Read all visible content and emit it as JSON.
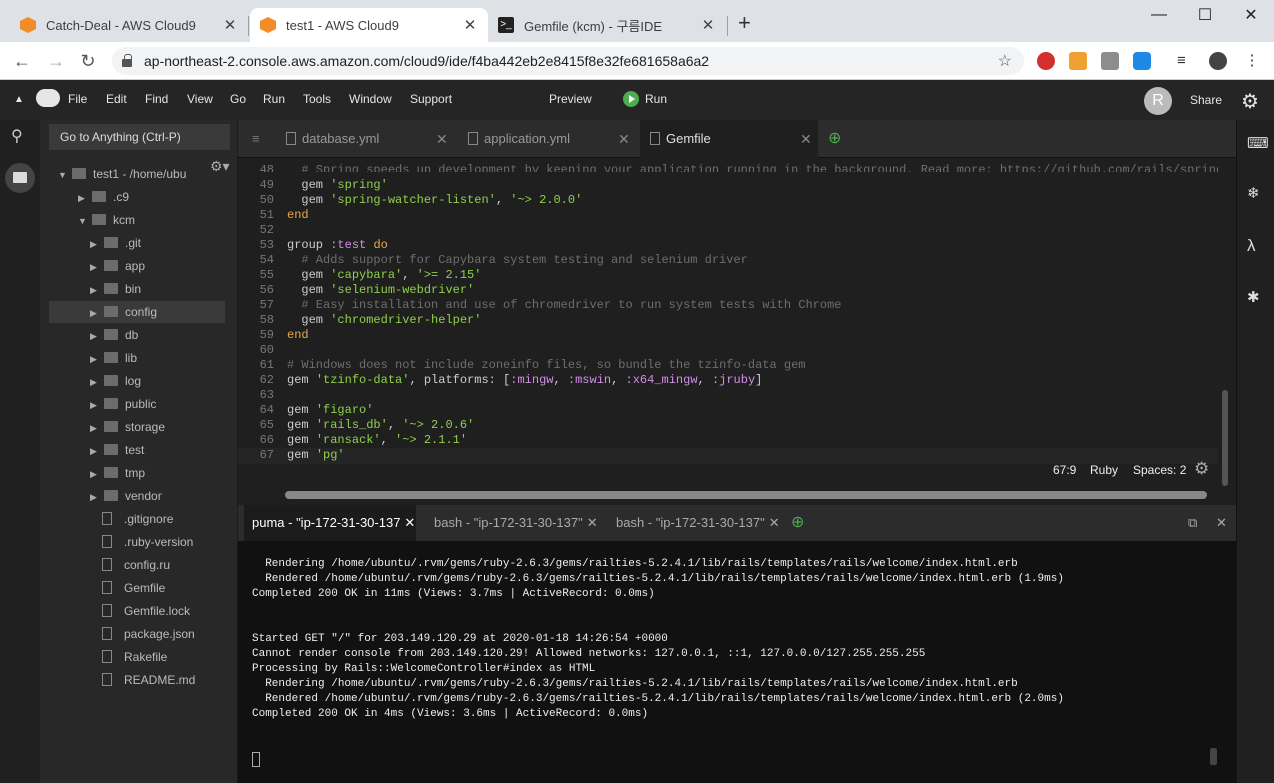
{
  "browser": {
    "tabs": [
      {
        "title": "Catch-Deal - AWS Cloud9",
        "icon": "cloud9-cube-icon"
      },
      {
        "title": "test1 - AWS Cloud9",
        "icon": "cloud9-cube-icon"
      },
      {
        "title": "Gemfile (kcm) - 구름IDE",
        "icon": "terminal-icon"
      }
    ],
    "url": "ap-northeast-2.console.aws.amazon.com/cloud9/ide/f4ba442eb2e8415f8e32fe681658a6a2",
    "new_tab": "+"
  },
  "menu": {
    "items": [
      "File",
      "Edit",
      "Find",
      "View",
      "Go",
      "Run",
      "Tools",
      "Window",
      "Support"
    ],
    "preview": "Preview",
    "run": "Run",
    "avatar": "R",
    "share": "Share"
  },
  "sidebar": {
    "goto": "Go to Anything (Ctrl-P)",
    "tree": [
      {
        "label": "test1 - /home/ubu",
        "depth": 0,
        "type": "folder",
        "open": true
      },
      {
        "label": ".c9",
        "depth": 1,
        "type": "folder"
      },
      {
        "label": "kcm",
        "depth": 1,
        "type": "folder",
        "open": true
      },
      {
        "label": ".git",
        "depth": 2,
        "type": "folder"
      },
      {
        "label": "app",
        "depth": 2,
        "type": "folder"
      },
      {
        "label": "bin",
        "depth": 2,
        "type": "folder"
      },
      {
        "label": "config",
        "depth": 2,
        "type": "folder",
        "selected": true
      },
      {
        "label": "db",
        "depth": 2,
        "type": "folder"
      },
      {
        "label": "lib",
        "depth": 2,
        "type": "folder"
      },
      {
        "label": "log",
        "depth": 2,
        "type": "folder"
      },
      {
        "label": "public",
        "depth": 2,
        "type": "folder"
      },
      {
        "label": "storage",
        "depth": 2,
        "type": "folder"
      },
      {
        "label": "test",
        "depth": 2,
        "type": "folder"
      },
      {
        "label": "tmp",
        "depth": 2,
        "type": "folder"
      },
      {
        "label": "vendor",
        "depth": 2,
        "type": "folder"
      },
      {
        "label": ".gitignore",
        "depth": 2,
        "type": "file"
      },
      {
        "label": ".ruby-version",
        "depth": 2,
        "type": "file"
      },
      {
        "label": "config.ru",
        "depth": 2,
        "type": "file"
      },
      {
        "label": "Gemfile",
        "depth": 2,
        "type": "file"
      },
      {
        "label": "Gemfile.lock",
        "depth": 2,
        "type": "file"
      },
      {
        "label": "package.json",
        "depth": 2,
        "type": "file"
      },
      {
        "label": "Rakefile",
        "depth": 2,
        "type": "file"
      },
      {
        "label": "README.md",
        "depth": 2,
        "type": "file"
      }
    ]
  },
  "editor": {
    "tabs": [
      "database.yml",
      "application.yml",
      "Gemfile"
    ],
    "active_tab": "Gemfile",
    "lines": [
      {
        "n": "48",
        "t": "  # Spring speeds up development by keeping your application running in the background. Read more: https://github.com/rails/spring"
      },
      {
        "n": "49",
        "t": "  gem 'spring'"
      },
      {
        "n": "50",
        "t": "  gem 'spring-watcher-listen', '~> 2.0.0'"
      },
      {
        "n": "51",
        "t": "end"
      },
      {
        "n": "52",
        "t": ""
      },
      {
        "n": "53",
        "t": "group :test do"
      },
      {
        "n": "54",
        "t": "  # Adds support for Capybara system testing and selenium driver"
      },
      {
        "n": "55",
        "t": "  gem 'capybara', '>= 2.15'"
      },
      {
        "n": "56",
        "t": "  gem 'selenium-webdriver'"
      },
      {
        "n": "57",
        "t": "  # Easy installation and use of chromedriver to run system tests with Chrome"
      },
      {
        "n": "58",
        "t": "  gem 'chromedriver-helper'"
      },
      {
        "n": "59",
        "t": "end"
      },
      {
        "n": "60",
        "t": ""
      },
      {
        "n": "61",
        "t": "# Windows does not include zoneinfo files, so bundle the tzinfo-data gem"
      },
      {
        "n": "62",
        "t": "gem 'tzinfo-data', platforms: [:mingw, :mswin, :x64_mingw, :jruby]"
      },
      {
        "n": "63",
        "t": ""
      },
      {
        "n": "64",
        "t": "gem 'figaro'"
      },
      {
        "n": "65",
        "t": "gem 'rails_db', '~> 2.0.6'"
      },
      {
        "n": "66",
        "t": "gem 'ransack', '~> 2.1.1'"
      },
      {
        "n": "67",
        "t": "gem 'pg'"
      }
    ],
    "status": {
      "position": "67:9",
      "mode": "Ruby",
      "spaces": "Spaces: 2"
    }
  },
  "terminal": {
    "tabs": [
      "puma - \"ip-172-31-30-137",
      "bash - \"ip-172-31-30-137\"",
      "bash - \"ip-172-31-30-137\""
    ],
    "lines": [
      "  Rendering /home/ubuntu/.rvm/gems/ruby-2.6.3/gems/railties-5.2.4.1/lib/rails/templates/rails/welcome/index.html.erb",
      "  Rendered /home/ubuntu/.rvm/gems/ruby-2.6.3/gems/railties-5.2.4.1/lib/rails/templates/rails/welcome/index.html.erb (1.9ms)",
      "Completed 200 OK in 11ms (Views: 3.7ms | ActiveRecord: 0.0ms)",
      "",
      "",
      "Started GET \"/\" for 203.149.120.29 at 2020-01-18 14:26:54 +0000",
      "Cannot render console from 203.149.120.29! Allowed networks: 127.0.0.1, ::1, 127.0.0.0/127.255.255.255",
      "Processing by Rails::WelcomeController#index as HTML",
      "  Rendering /home/ubuntu/.rvm/gems/ruby-2.6.3/gems/railties-5.2.4.1/lib/rails/templates/rails/welcome/index.html.erb",
      "  Rendered /home/ubuntu/.rvm/gems/ruby-2.6.3/gems/railties-5.2.4.1/lib/rails/templates/rails/welcome/index.html.erb (2.0ms)",
      "Completed 200 OK in 4ms (Views: 3.6ms | ActiveRecord: 0.0ms)"
    ]
  }
}
